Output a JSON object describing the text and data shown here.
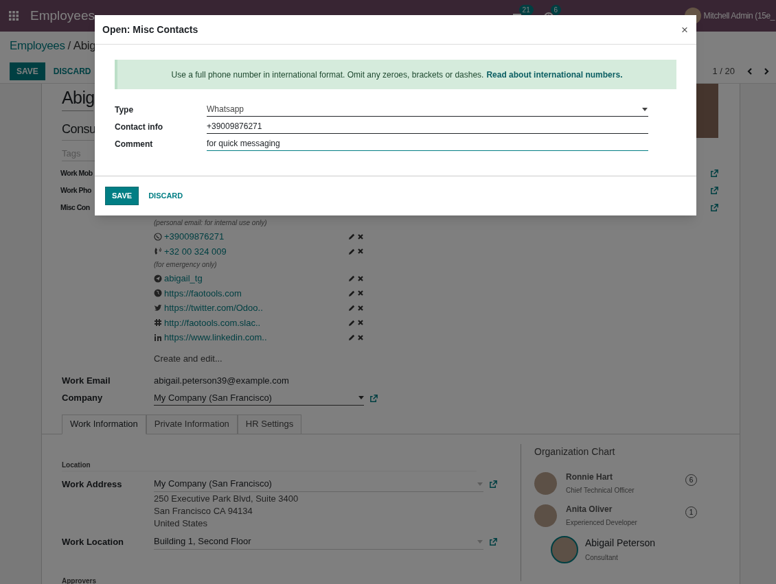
{
  "navbar": {
    "app_name": "Employees",
    "badges": [
      {
        "count": "21",
        "kind": "chat"
      },
      {
        "count": "6",
        "kind": "activity"
      }
    ],
    "user": "Mitchell Admin (15e_"
  },
  "control_panel": {
    "breadcrumb": [
      {
        "label": "Employees"
      },
      {
        "label": "Abig"
      }
    ],
    "breadcrumb_separator": "/",
    "buttons": [
      {
        "label": "SAVE",
        "kind": "primary"
      },
      {
        "label": "DISCARD",
        "kind": "link"
      }
    ],
    "pager": "1 / 20"
  },
  "form": {
    "name": "Abig",
    "job_title": "Consu",
    "tags_placeholder": "Tags",
    "top_labels": [
      "Work Mob",
      "Work Pho",
      "Misc Con"
    ],
    "misc_contacts": [
      {
        "kind": "note",
        "text": "(personal email: for internal use only)"
      },
      {
        "kind": "whatsapp",
        "text": "+39009876271"
      },
      {
        "kind": "phone",
        "text": "+32 00 324 009"
      },
      {
        "kind": "note",
        "text": "(for emergency only)"
      },
      {
        "kind": "telegram",
        "text": "abigail_tg"
      },
      {
        "kind": "globe",
        "text": "https://faotools.com"
      },
      {
        "kind": "twitter",
        "text": "https://twitter.com/Odoo.."
      },
      {
        "kind": "slack",
        "text": "http://faotools.com.slac.."
      },
      {
        "kind": "linkedin",
        "text": "https://www.linkedin.com.."
      }
    ],
    "create_edit": "Create and edit...",
    "fields": [
      {
        "label": "Work Email",
        "value": "abigail.peterson39@example.com",
        "kind": "text"
      },
      {
        "label": "Company",
        "value": "My Company (San Francisco)",
        "kind": "select"
      }
    ],
    "tabs": [
      {
        "label": "Work Information",
        "selected": true
      },
      {
        "label": "Private Information",
        "selected": false
      },
      {
        "label": "HR Settings",
        "selected": false
      }
    ],
    "work_info": {
      "location_heading": "Location",
      "rows": [
        {
          "label": "Work Address",
          "value": "My Company (San Francisco)",
          "address": [
            "250 Executive Park Blvd, Suite 3400",
            "San Francisco CA 94134",
            "United States"
          ]
        },
        {
          "label": "Work Location",
          "value": "Building 1, Second Floor",
          "address": []
        }
      ],
      "approvers_heading": "Approvers"
    },
    "org_chart": {
      "title": "Organization Chart",
      "people": [
        {
          "name": "Ronnie Hart",
          "job": "Chief Technical Officer",
          "count": "6",
          "selected": false
        },
        {
          "name": "Anita Oliver",
          "job": "Experienced Developer",
          "count": "1",
          "selected": false
        },
        {
          "name": "Abigail Peterson",
          "job": "Consultant",
          "selected": true
        }
      ]
    }
  },
  "dialog": {
    "title": "Open: Misc Contacts",
    "close": "×",
    "alert": {
      "text": "Use a full phone number in international format. Omit any zeroes, brackets or dashes.",
      "link": "Read about international numbers."
    },
    "fields": [
      {
        "label": "Type",
        "value": "Whatsapp",
        "kind": "select",
        "focused": false
      },
      {
        "label": "Contact info",
        "value": "+39009876271",
        "kind": "text",
        "focused": false
      },
      {
        "label": "Comment",
        "value": "for quick messaging",
        "kind": "text",
        "focused": true
      }
    ],
    "buttons": [
      {
        "label": "SAVE",
        "kind": "primary"
      },
      {
        "label": "DISCARD",
        "kind": "link"
      }
    ]
  }
}
